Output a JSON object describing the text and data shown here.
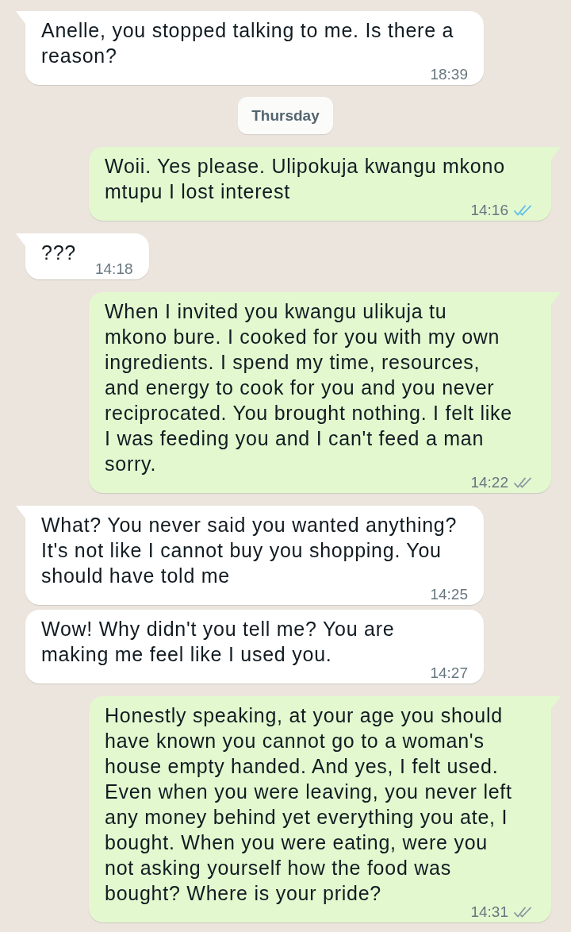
{
  "messages": [
    {
      "kind": "incoming",
      "tail": true,
      "text": "Anelle, you stopped talking to me. Is there a reason?",
      "time": "18:39"
    },
    {
      "kind": "date",
      "text": "Thursday"
    },
    {
      "kind": "outgoing",
      "tail": true,
      "text": "Woii. Yes please. Ulipokuja kwangu mkono mtupu I lost interest",
      "time": "14:16",
      "read": true
    },
    {
      "kind": "incoming",
      "tail": true,
      "text": "???",
      "time": "14:18"
    },
    {
      "kind": "outgoing",
      "tail": true,
      "text": "When I invited you kwangu ulikuja tu mkono bure. I cooked for you with my own ingredients. I spend my time, resources, and energy to cook for you and you never reciprocated. You brought nothing. I felt like I was feeding you and I can't feed a man sorry.",
      "time": "14:22",
      "read": false
    },
    {
      "kind": "incoming",
      "tail": true,
      "text": "What? You never said you wanted anything? It's not like I cannot buy you shopping. You should have told me",
      "time": "14:25"
    },
    {
      "kind": "incoming",
      "tail": false,
      "text": "Wow! Why didn't you tell me? You are making me feel like I used you.",
      "time": "14:27"
    },
    {
      "kind": "outgoing",
      "tail": true,
      "text": "Honestly speaking, at your age you should have known you cannot go to a woman's house empty handed. And yes, I felt used. Even when you were leaving, you never left any money behind yet everything you ate, I bought. When you were eating, were you not asking yourself how the food was bought? Where is your pride?",
      "time": "14:31",
      "read": false
    }
  ]
}
